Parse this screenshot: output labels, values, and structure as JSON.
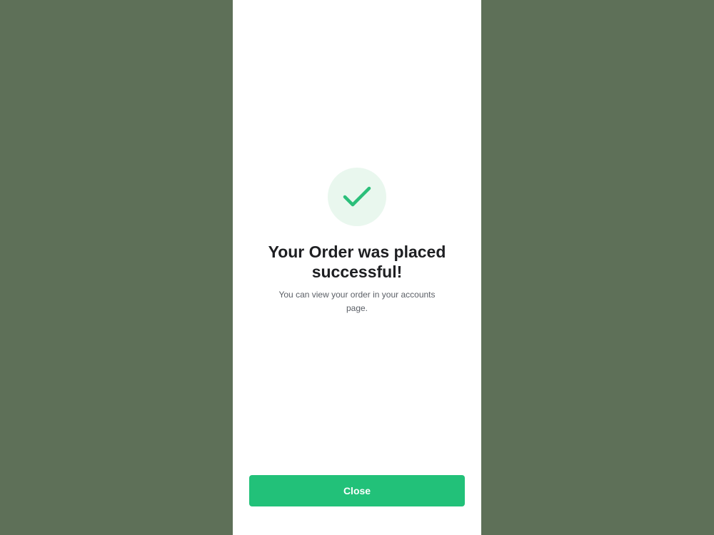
{
  "success": {
    "icon": "check-icon",
    "title": "Your Order was placed successful!",
    "message": "You can view your order in your accounts page."
  },
  "actions": {
    "close_label": "Close"
  },
  "colors": {
    "backdrop": "#5e7058",
    "screen": "#ffffff",
    "accent": "#22c179",
    "icon_bg": "#e9f7ee",
    "title": "#1e1f22",
    "message": "#5b5f66"
  }
}
